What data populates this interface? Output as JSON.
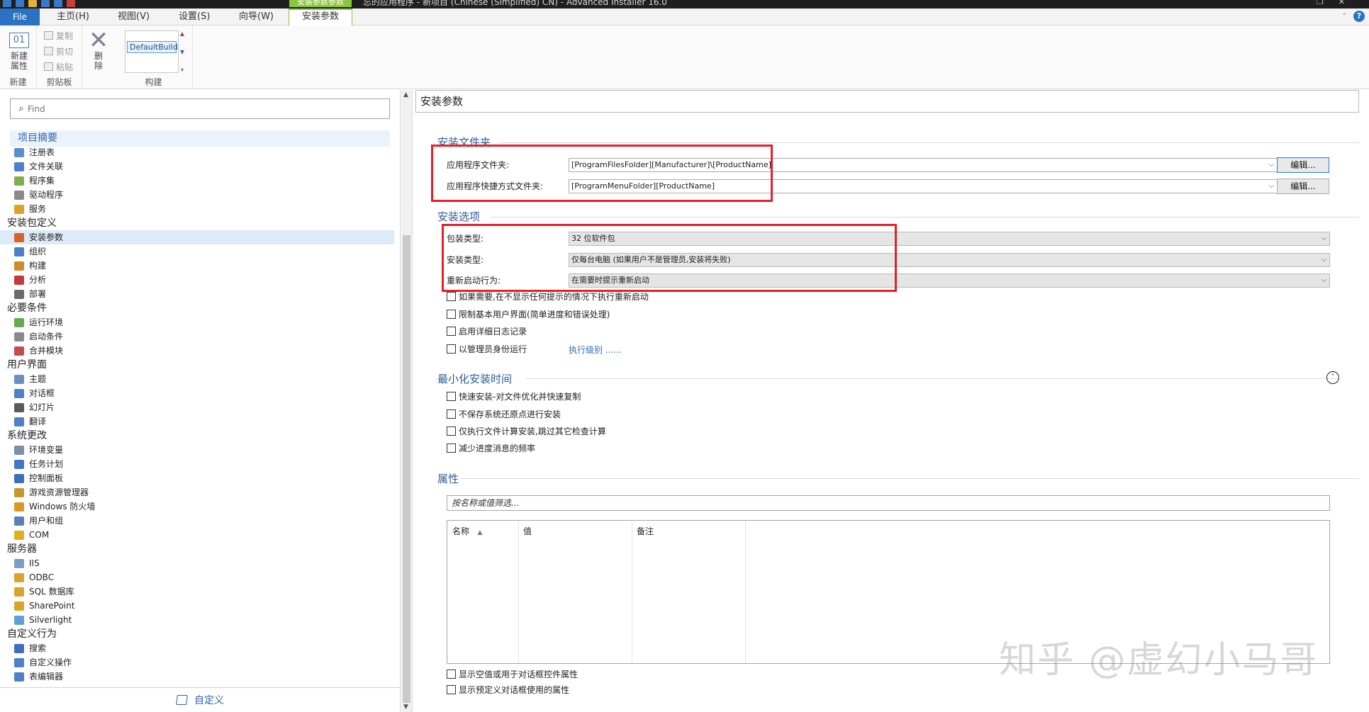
{
  "titlebar": {
    "context_tab": "安装参数参数",
    "window_title": "忘的应用程序 - 新项目 (Chinese (Simplified) CN) - Advanced Installer 16.0"
  },
  "menu": {
    "file": "File",
    "tabs": [
      "主页(H)",
      "视图(V)",
      "设置(S)",
      "向导(W)"
    ],
    "active_tab": "安装参数",
    "help": "?"
  },
  "ribbon": {
    "new": {
      "icon_text": "01",
      "label_line1": "新建",
      "label_line2": "属性",
      "group": "新建"
    },
    "clipboard": {
      "copy": "复制",
      "cut": "剪切",
      "paste": "粘贴",
      "group": "剪贴板"
    },
    "delete": {
      "line1": "删",
      "line2": "除"
    },
    "build": {
      "selected": "DefaultBuild",
      "group": "构建"
    }
  },
  "left": {
    "search_placeholder": "Find",
    "header": "项目摘要",
    "items": [
      {
        "type": "item",
        "label": "注册表",
        "color": "#5b8dd0"
      },
      {
        "type": "item",
        "label": "文件关联",
        "color": "#4f7fc8"
      },
      {
        "type": "item",
        "label": "程序集",
        "color": "#7fae4a"
      },
      {
        "type": "item",
        "label": "驱动程序",
        "color": "#8a8a8a"
      },
      {
        "type": "item",
        "label": "服务",
        "color": "#d8a42a"
      },
      {
        "type": "cat",
        "label": "安装包定义"
      },
      {
        "type": "item",
        "label": "安装参数",
        "color": "#d4642a",
        "selected": true
      },
      {
        "type": "item",
        "label": "组织",
        "color": "#4f7fc8"
      },
      {
        "type": "item",
        "label": "构建",
        "color": "#d08a2a"
      },
      {
        "type": "item",
        "label": "分析",
        "color": "#c23b3b"
      },
      {
        "type": "item",
        "label": "部署",
        "color": "#6b6b6b"
      },
      {
        "type": "cat",
        "label": "必要条件"
      },
      {
        "type": "item",
        "label": "运行环境",
        "color": "#6aa84f"
      },
      {
        "type": "item",
        "label": "启动条件",
        "color": "#8a8a8a"
      },
      {
        "type": "item",
        "label": "合并模块",
        "color": "#c54c4c"
      },
      {
        "type": "cat",
        "label": "用户界面"
      },
      {
        "type": "item",
        "label": "主题",
        "color": "#6b8fbf"
      },
      {
        "type": "item",
        "label": "对话框",
        "color": "#4f7fc8"
      },
      {
        "type": "item",
        "label": "幻灯片",
        "color": "#5a5a5a"
      },
      {
        "type": "item",
        "label": "翻译",
        "color": "#4f7fc8"
      },
      {
        "type": "cat",
        "label": "系统更改"
      },
      {
        "type": "item",
        "label": "环境变量",
        "color": "#7b8fa8"
      },
      {
        "type": "item",
        "label": "任务计划",
        "color": "#3f78c2"
      },
      {
        "type": "item",
        "label": "控制面板",
        "color": "#3f6fb8"
      },
      {
        "type": "item",
        "label": "游戏资源管理器",
        "color": "#c7962a"
      },
      {
        "type": "item",
        "label": "Windows 防火墙",
        "color": "#d59a2a"
      },
      {
        "type": "item",
        "label": "用户和组",
        "color": "#5b7fb8"
      },
      {
        "type": "item",
        "label": "COM",
        "color": "#e0b020"
      },
      {
        "type": "cat",
        "label": "服务器"
      },
      {
        "type": "item",
        "label": "IIS",
        "color": "#7a9cc6"
      },
      {
        "type": "item",
        "label": "ODBC",
        "color": "#d8a42a"
      },
      {
        "type": "item",
        "label": "SQL 数据库",
        "color": "#d8a42a"
      },
      {
        "type": "item",
        "label": "SharePoint",
        "color": "#d8a42a"
      },
      {
        "type": "item",
        "label": "Silverlight",
        "color": "#5ba0d8"
      },
      {
        "type": "cat",
        "label": "自定义行为"
      },
      {
        "type": "item",
        "label": "搜索",
        "color": "#3f6fb8"
      },
      {
        "type": "item",
        "label": "自定义操作",
        "color": "#4f7fc8"
      },
      {
        "type": "item",
        "label": "表编辑器",
        "color": "#4f7fc8"
      }
    ],
    "footer": "自定义"
  },
  "main": {
    "page_title": "安装参数",
    "folders": {
      "title": "安装文件夹",
      "app_folder_label": "应用程序文件夹:",
      "app_folder_value": "[ProgramFilesFolder][Manufacturer]\\[ProductName]",
      "shortcut_label": "应用程序快捷方式文件夹:",
      "shortcut_value": "[ProgramMenuFolder][ProductName]",
      "edit_label": "编辑..."
    },
    "options": {
      "title": "安装选项",
      "package_type_label": "包装类型:",
      "package_type_value": "32 位软件包",
      "install_type_label": "安装类型:",
      "install_type_value": "仅每台电脑 (如果用户不是管理员,安装将失败)",
      "reboot_label": "重新启动行为:",
      "reboot_value": "在需要时提示重新启动",
      "checkboxes": [
        "如果需要,在不显示任何提示的情况下执行重新启动",
        "限制基本用户界面(简单进度和错误处理)",
        "启用详细日志记录",
        "以管理员身份运行"
      ],
      "exec_level_link": "执行级别 ......"
    },
    "minimize": {
      "title": "最小化安装时间",
      "checkboxes": [
        "快速安装-对文件优化并快速复制",
        "不保存系统还原点进行安装",
        "仅执行文件计算安装,跳过其它检查计算",
        "减少进度消息的频率"
      ]
    },
    "properties": {
      "title": "属性",
      "filter_placeholder": "按名称或值筛选...",
      "columns": [
        "名称",
        "值",
        "备注"
      ],
      "checkboxes": [
        "显示空值或用于对话框控件属性",
        "显示预定义对话框使用的属性"
      ]
    }
  },
  "watermark": "知乎 @虚幻小马哥"
}
